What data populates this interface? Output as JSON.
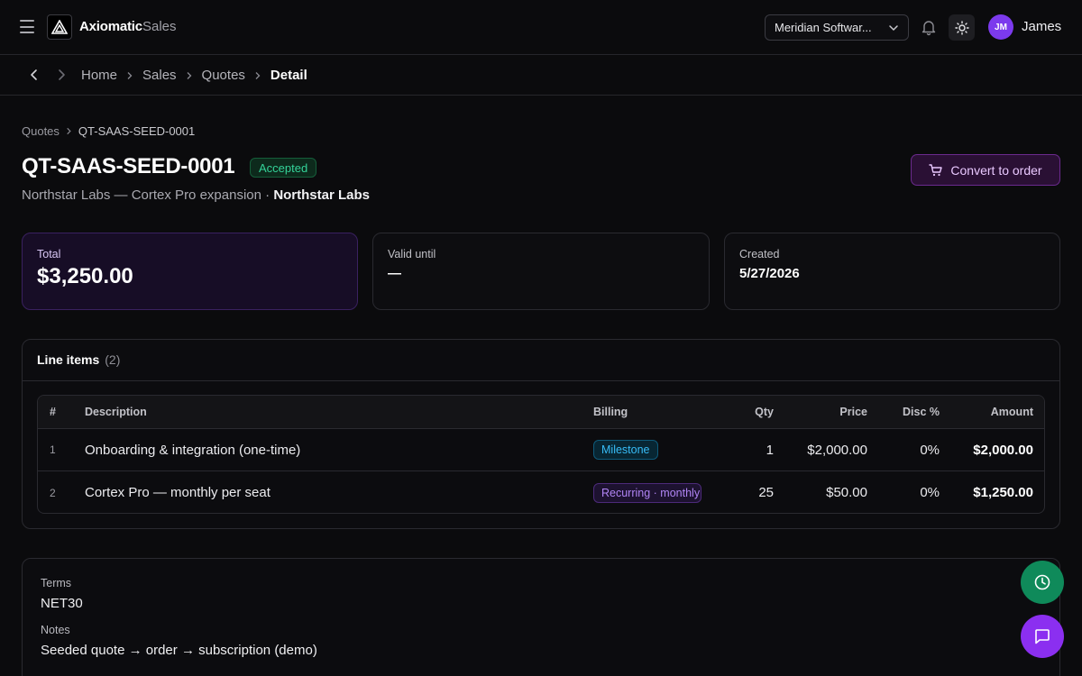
{
  "app": {
    "brand": "Axiomatic",
    "brand_sub": "Sales"
  },
  "header": {
    "org_select": "Meridian Softwar...",
    "user": {
      "initials": "JM",
      "name": "James"
    }
  },
  "nav": {
    "crumbs": [
      {
        "label": "Home"
      },
      {
        "label": "Sales"
      },
      {
        "label": "Quotes"
      },
      {
        "label": "Detail"
      }
    ]
  },
  "page": {
    "subcrumb": {
      "parent": "Quotes",
      "current": "QT-SAAS-SEED-0001"
    },
    "title": "QT-SAAS-SEED-0001",
    "status": "Accepted",
    "subtitle_main": "Northstar Labs — Cortex Pro expansion",
    "subtitle_sep": " · ",
    "subtitle_customer": "Northstar Labs",
    "convert_label": "Convert to order"
  },
  "cards": {
    "total": {
      "label": "Total",
      "value": "$3,250.00"
    },
    "valid": {
      "label": "Valid until",
      "value": "—"
    },
    "created": {
      "label": "Created",
      "value": "5/27/2026"
    }
  },
  "line_items": {
    "title": "Line items",
    "count": "(2)",
    "columns": {
      "num": "#",
      "desc": "Description",
      "billing": "Billing",
      "qty": "Qty",
      "price": "Price",
      "disc": "Disc %",
      "amount": "Amount"
    },
    "rows": [
      {
        "num": "1",
        "desc": "Onboarding & integration (one-time)",
        "billing": "Milestone",
        "qty": "1",
        "price": "$2,000.00",
        "disc": "0%",
        "amount": "$2,000.00"
      },
      {
        "num": "2",
        "desc": "Cortex Pro — monthly per seat",
        "billing": "Recurring · monthly",
        "qty": "25",
        "price": "$50.00",
        "disc": "0%",
        "amount": "$1,250.00"
      }
    ]
  },
  "terms": {
    "terms_label": "Terms",
    "terms_value": "NET30",
    "notes_label": "Notes",
    "notes_value": "Seeded quote → order → subscription (demo)"
  },
  "colors": {
    "accent": "#8b2ff0",
    "success": "#34d399",
    "info": "#38bdf8",
    "background": "#0b0b0d"
  }
}
